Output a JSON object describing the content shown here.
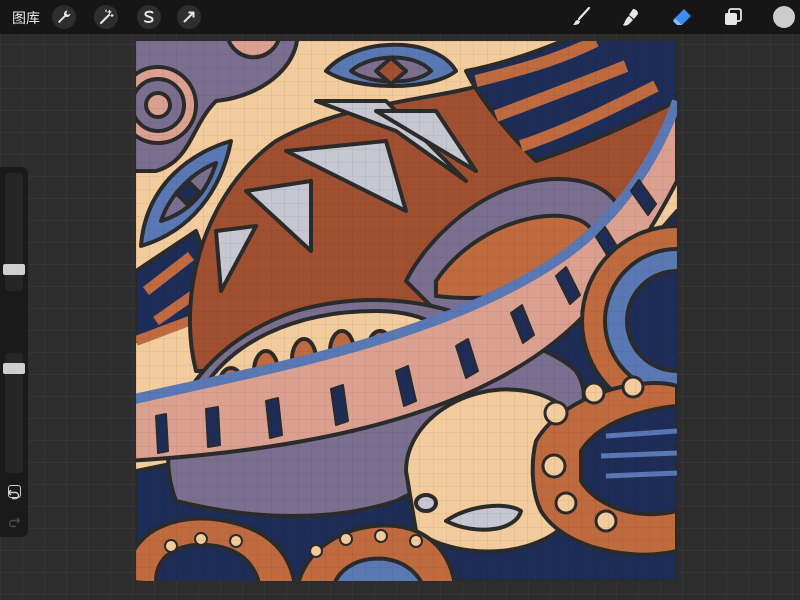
{
  "topbar": {
    "gallery_label": "图库",
    "left_tools": [
      {
        "name": "actions",
        "icon": "wrench-icon"
      },
      {
        "name": "adjustments",
        "icon": "magic-wand-icon"
      },
      {
        "name": "selection",
        "icon": "selection-s-icon"
      },
      {
        "name": "transform",
        "icon": "arrow-cursor-icon"
      }
    ],
    "right_tools": [
      {
        "name": "brush",
        "icon": "brush-icon"
      },
      {
        "name": "smudge",
        "icon": "smudge-icon"
      },
      {
        "name": "eraser",
        "icon": "eraser-icon",
        "active": true
      },
      {
        "name": "layers",
        "icon": "layers-icon"
      },
      {
        "name": "color",
        "icon": "color-swatch-icon",
        "value": "#cccccc"
      }
    ]
  },
  "sidebar": {
    "brush_size_level": 0.65,
    "opacity_level": 0.22,
    "icons": [
      "modify-square-icon",
      "undo-icon",
      "redo-icon"
    ]
  },
  "canvas": {
    "content": "patterned-illustration",
    "palette": {
      "cream": "#f2cc9c",
      "rust": "#a05030",
      "navy": "#1e2d57",
      "blue": "#5a78b4",
      "mauve": "#7b6f8f",
      "pink": "#dca090",
      "grey": "#c6c7d1",
      "outline": "#2b2b2b",
      "orange": "#c06a40"
    }
  }
}
